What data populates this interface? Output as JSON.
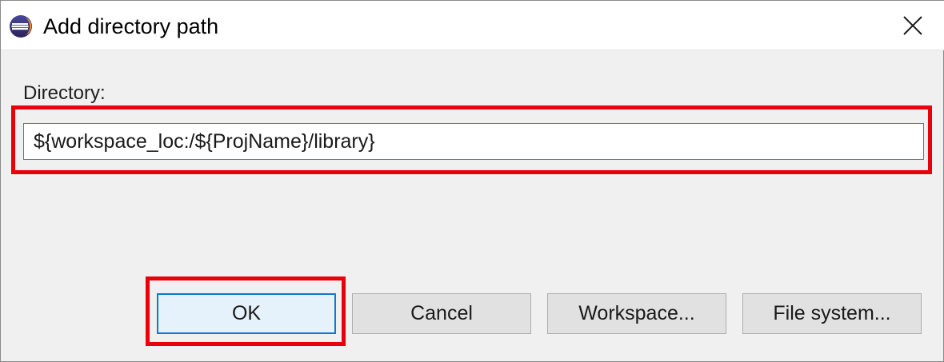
{
  "window": {
    "title": "Add directory path",
    "app_icon": "eclipse-icon",
    "close_icon": "close-icon"
  },
  "form": {
    "directory_label": "Directory:",
    "directory_value": "${workspace_loc:/${ProjName}/library}"
  },
  "buttons": {
    "ok": "OK",
    "cancel": "Cancel",
    "workspace": "Workspace...",
    "file_system": "File system..."
  },
  "colors": {
    "highlight": "#e8000b",
    "focus_border": "#0a78d7",
    "dialog_background": "#f0f0f0"
  }
}
